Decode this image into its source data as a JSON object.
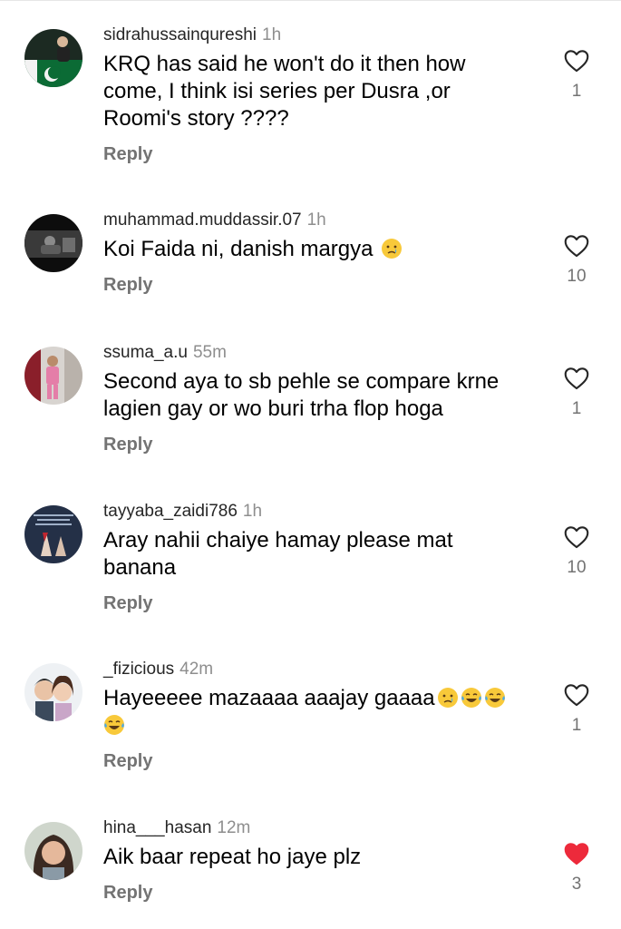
{
  "reply_label": "Reply",
  "colors": {
    "heart_outline": "#262626",
    "heart_liked": "#ed2a3b",
    "meta_gray": "#8e8e8e",
    "reply_gray": "#737373"
  },
  "comments": [
    {
      "username": "sidrahussainqureshi",
      "time": "1h",
      "lines": [
        "KRQ has said he won't do it then how",
        "come, I think isi series per Dusra ,or",
        "Roomi's story ????"
      ],
      "emojis": [],
      "likes": "1",
      "liked": false,
      "avatar": "flag-profile-avatar"
    },
    {
      "username": "muhammad.muddassir.07",
      "time": "1h",
      "lines": [
        "Koi Faida ni, danish margya"
      ],
      "emojis": [
        "crying-face-emoji"
      ],
      "likes": "10",
      "liked": false,
      "avatar": "dark-photo-avatar"
    },
    {
      "username": "ssuma_a.u",
      "time": "55m",
      "lines": [
        "Second aya to sb pehle se compare krne",
        "lagien gay or wo buri trha flop hoga"
      ],
      "emojis": [],
      "likes": "1",
      "liked": false,
      "avatar": "person-pink-avatar"
    },
    {
      "username": "tayyaba_zaidi786",
      "time": "1h",
      "lines": [
        "Aray nahii chaiye hamay please mat",
        "banana"
      ],
      "emojis": [],
      "likes": "10",
      "liked": false,
      "avatar": "quote-image-avatar"
    },
    {
      "username": "_fizicious",
      "time": "42m",
      "lines": [
        "Hayeeeee mazaaaa aaajay gaaaa"
      ],
      "emojis": [
        "crying-face-emoji",
        "tears-of-joy-emoji",
        "tears-of-joy-emoji",
        "tears-of-joy-emoji"
      ],
      "likes": "1",
      "liked": false,
      "avatar": "cartoon-couple-avatar"
    },
    {
      "username": "hina___hasan",
      "time": "12m",
      "lines": [
        "Aik baar repeat ho jaye plz"
      ],
      "emojis": [],
      "likes": "3",
      "liked": true,
      "avatar": "woman-portrait-avatar"
    }
  ]
}
